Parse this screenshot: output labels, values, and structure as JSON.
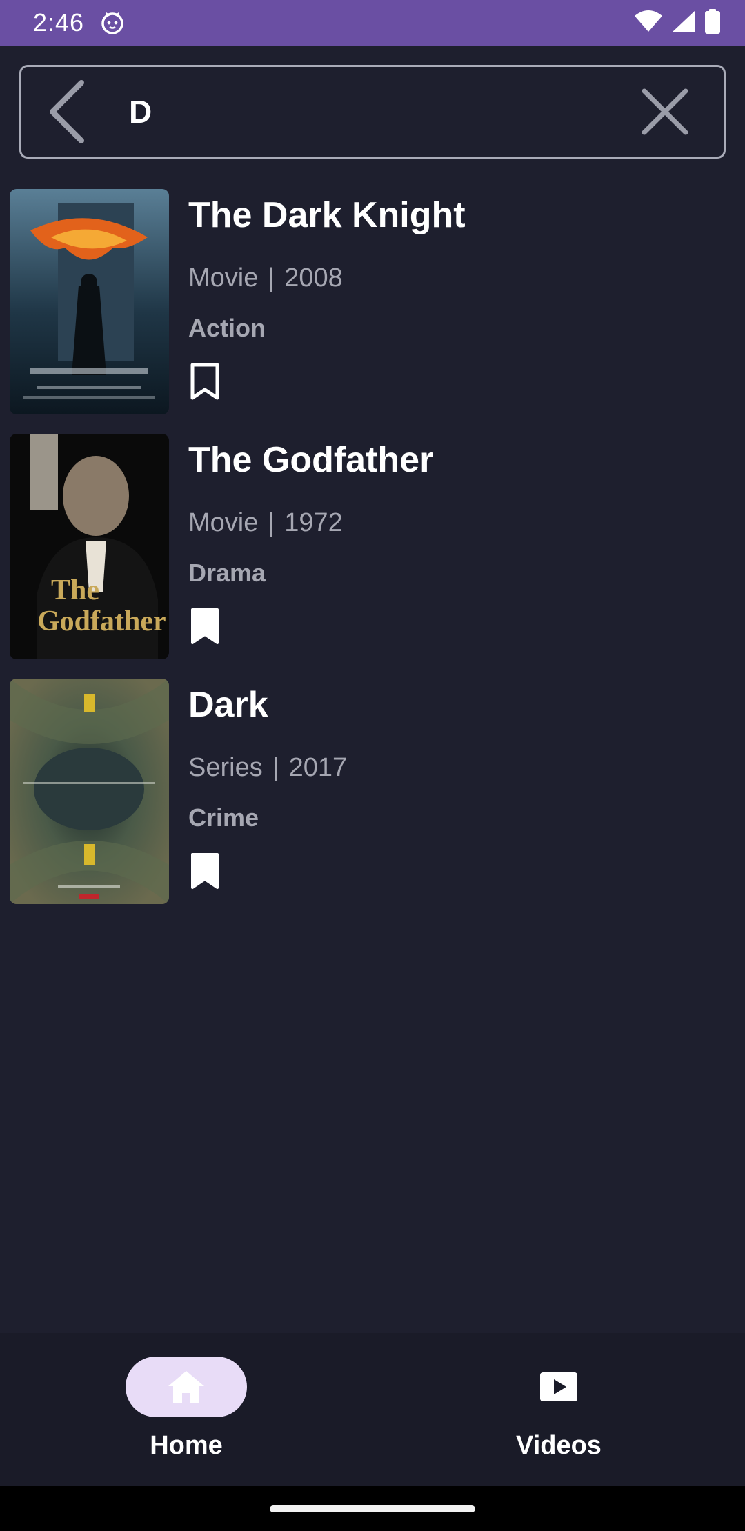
{
  "status_bar": {
    "time": "2:46",
    "icons": [
      "cat-notification-icon",
      "wifi-icon",
      "signal-icon",
      "battery-icon"
    ],
    "background": "#6a4fa3"
  },
  "search": {
    "value": "D",
    "placeholder": "",
    "back_icon": "chevron-left-icon",
    "clear_icon": "close-icon"
  },
  "results": [
    {
      "title": "The Dark Knight",
      "type": "Movie",
      "separator": "|",
      "year": "2008",
      "genre": "Action",
      "bookmarked": false
    },
    {
      "title": "The Godfather",
      "type": "Movie",
      "separator": "|",
      "year": "1972",
      "genre": "Drama",
      "bookmarked": true
    },
    {
      "title": "Dark",
      "type": "Series",
      "separator": "|",
      "year": "2017",
      "genre": "Crime",
      "bookmarked": true
    }
  ],
  "bottom_nav": {
    "items": [
      {
        "label": "Home",
        "icon": "home-icon",
        "active": true
      },
      {
        "label": "Videos",
        "icon": "play-icon",
        "active": false
      }
    ]
  },
  "colors": {
    "background": "#1e1f2e",
    "muted_text": "#a6a7b2",
    "active_pill": "#e8dcf7"
  }
}
